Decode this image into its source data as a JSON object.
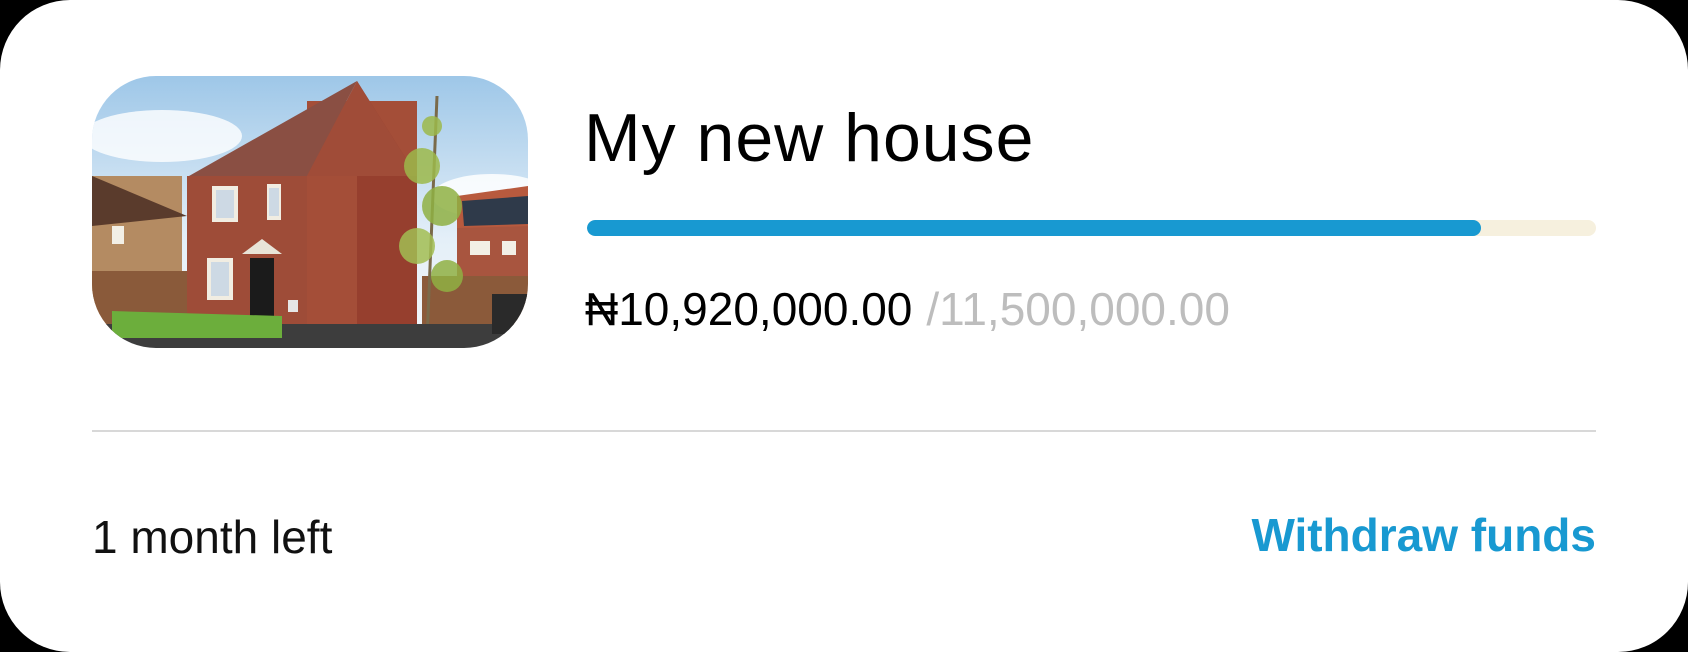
{
  "goal": {
    "title": "My new house",
    "image_icon": "house-photo",
    "saved_amount": "₦10,920,000.00",
    "target_amount": "/11,500,000.00",
    "progress": 0.886,
    "time_left": "1 month left",
    "withdraw_label": "Withdraw funds"
  },
  "colors": {
    "accent": "#1899d1",
    "progress_track": "#f6f0de",
    "muted_text": "#bdbdbd",
    "divider": "#d8d8d8"
  }
}
